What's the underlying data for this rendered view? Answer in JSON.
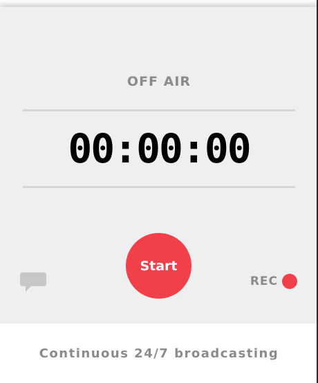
{
  "status_label": "OFF AIR",
  "timer": "00:00:00",
  "start_label": "Start",
  "rec_label": "REC",
  "footer_text": "Continuous 24/7 broadcasting",
  "icons": {
    "chat": "chat-bubble-icon",
    "record": "record-dot-icon"
  },
  "colors": {
    "accent": "#f2404b",
    "panel_bg": "#efefef",
    "muted_text": "#8b8b8b",
    "timer_text": "#000000"
  }
}
